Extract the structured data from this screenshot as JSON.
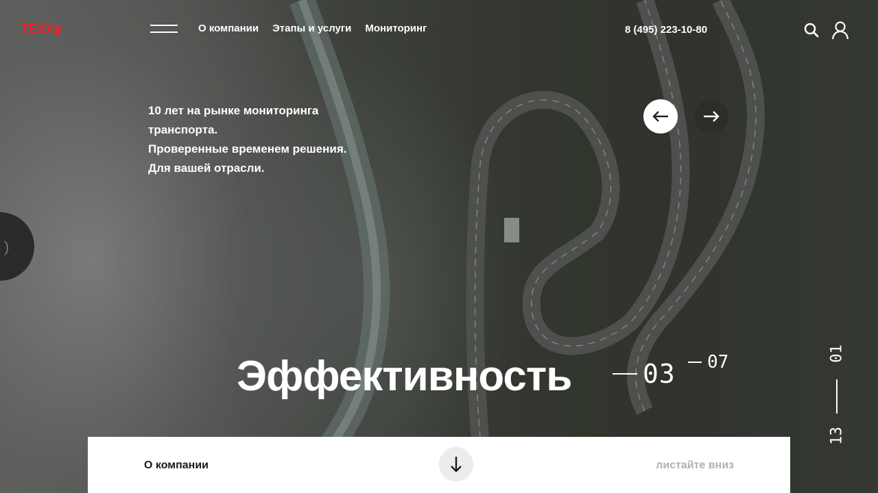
{
  "brand": {
    "logo_text": "TEXX",
    "logo_waves": ")))",
    "accent_color": "#e3262e"
  },
  "header": {
    "menu_icon": "hamburger-icon",
    "nav": [
      "О компании",
      "Этапы и услуги",
      "Мониторинг"
    ],
    "phone": "8 (495) 223-10-80",
    "search_icon": "search-icon",
    "user_icon": "user-icon"
  },
  "hero": {
    "lines": [
      "10 лет на рынке мониторинга",
      "транспорта.",
      "Проверенные временем решения.",
      "Для вашей отрасли."
    ],
    "prev_icon": "arrow-left-icon",
    "next_icon": "arrow-right-icon",
    "title": "Эффективность",
    "counter_current": "03",
    "counter_total": "07"
  },
  "side_widget": {
    "icon": "sound-wave-icon",
    "glyph": ")"
  },
  "vertical_pager": {
    "top": "01",
    "bottom": "13"
  },
  "bottom_bar": {
    "label": "О компании",
    "down_icon": "arrow-down-icon",
    "hint": "листайте вниз"
  }
}
